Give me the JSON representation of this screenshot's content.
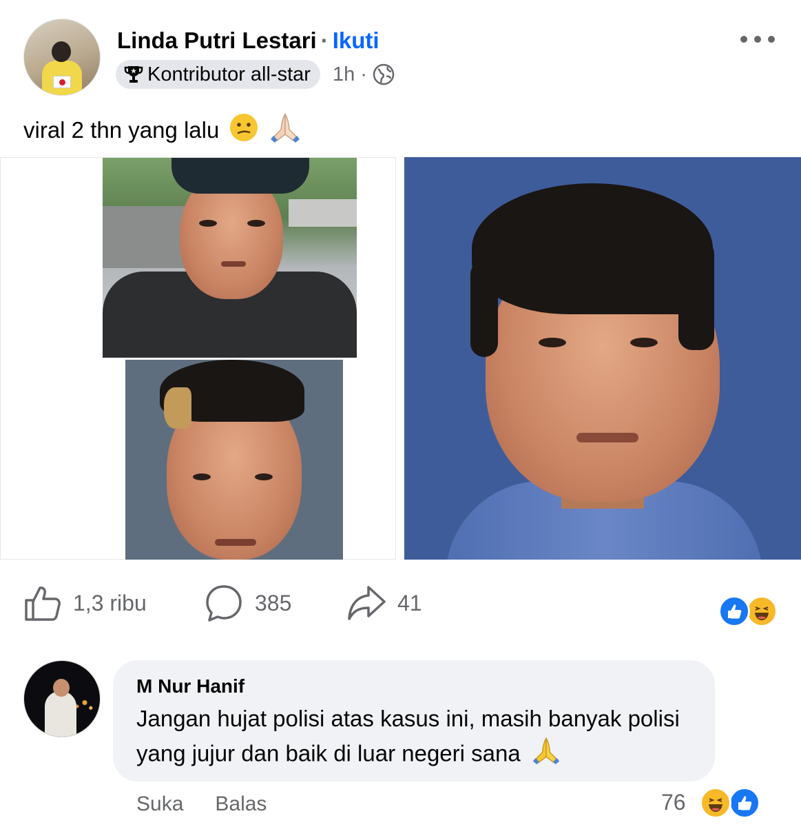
{
  "post": {
    "author": "Linda Putri Lestari",
    "separator": "·",
    "follow_label": "Ikuti",
    "badge_label": "Kontributor all-star",
    "time": "1h",
    "meta_dot": "·",
    "privacy_icon": "globe-icon",
    "caption": "viral 2 thn yang lalu",
    "caption_emojis": [
      "confused-face",
      "folded-hands"
    ]
  },
  "stats": {
    "likes": "1,3 ribu",
    "comments": "385",
    "shares": "41",
    "reactions": [
      "like",
      "haha"
    ]
  },
  "comment": {
    "author": "M Nur Hanif",
    "text": "Jangan hujat polisi atas kasus ini, masih banyak polisi yang jujur dan baik di luar negeri sana",
    "trailing_emoji": "folded-hands",
    "like_label": "Suka",
    "reply_label": "Balas",
    "reaction_count": "76",
    "reactions": [
      "haha",
      "like"
    ]
  },
  "colors": {
    "accent": "#0866ff",
    "secondary_text": "#65676b",
    "bubble": "#f0f2f5",
    "badge_bg": "#e4e6eb"
  }
}
